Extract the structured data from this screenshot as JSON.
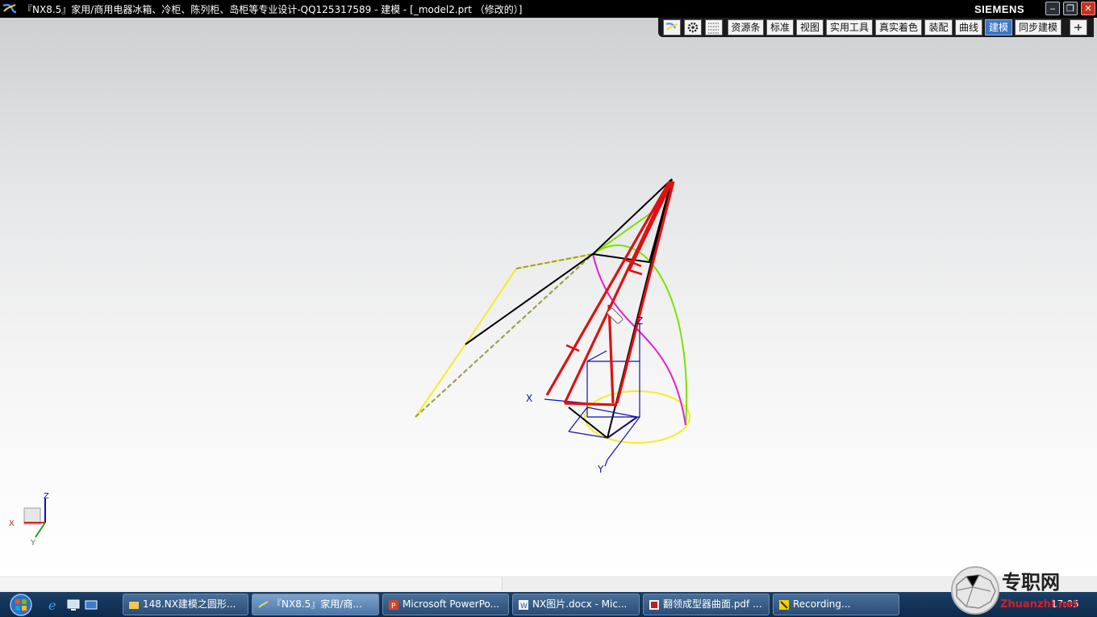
{
  "window": {
    "title": "『NX8.5』家用/商用电器冰箱、冷柜、陈列柜、岛柜等专业设计-QQ125317589 - 建模 - [_model2.prt （修改的）]",
    "brand": "SIEMENS",
    "min_label": "‒",
    "restore_label": "❐",
    "close_label": "✕"
  },
  "ribbon": {
    "tabs": [
      {
        "label": "资源条"
      },
      {
        "label": "标准"
      },
      {
        "label": "视图"
      },
      {
        "label": "实用工具"
      },
      {
        "label": "真实着色"
      },
      {
        "label": "装配"
      },
      {
        "label": "曲线"
      },
      {
        "label": "建模",
        "active": true
      },
      {
        "label": "同步建模"
      }
    ],
    "icons": [
      "nx-logo-icon",
      "gear-icon",
      "grid-icon",
      "dock-menu-icon"
    ]
  },
  "viewport": {
    "wcs_labels": {
      "x": "X",
      "y": "Y",
      "z": "Z"
    },
    "triad_labels": {
      "x": "X",
      "y": "Y",
      "z": "Z"
    },
    "background_top": "#cfd0d1",
    "background_bottom": "#ffffff",
    "curve_colors": {
      "red": "#e01010",
      "black": "#000000",
      "yellow": "#f2ee20",
      "green": "#7fe000",
      "magenta": "#e020d0",
      "blue": "#1010b0"
    }
  },
  "taskbar": {
    "tasks": [
      {
        "label": "148.NX建模之圆形...",
        "icon": "folder-icon"
      },
      {
        "label": "『NX8.5』家用/商...",
        "icon": "nx-app-icon",
        "active": true
      },
      {
        "label": "Microsoft PowerPo...",
        "icon": "powerpoint-icon"
      },
      {
        "label": "NX图片.docx - Mic...",
        "icon": "word-icon"
      },
      {
        "label": "翻领成型器曲面.pdf ...",
        "icon": "pdf-icon"
      },
      {
        "label": "Recording...",
        "icon": "recorder-icon"
      }
    ],
    "quick_launch": [
      "ie-icon",
      "show-desktop-icon",
      "switch-windows-icon"
    ],
    "clock": "17:05"
  },
  "watermark": {
    "text_cn": "专职网",
    "text_en": "Zhuanzhi.net"
  }
}
